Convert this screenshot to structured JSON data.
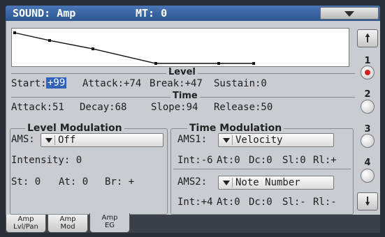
{
  "header": {
    "title": "SOUND: Amp",
    "mt": "MT: 0"
  },
  "level": {
    "section_title": "Level",
    "start_label": "Start:",
    "start_value": "+99",
    "attack": "Attack:+74",
    "break": "Break:+47",
    "sustain": "Sustain:0"
  },
  "time": {
    "section_title": "Time",
    "attack": "Attack:51",
    "decay": "Decay:68",
    "slope": "Slope:94",
    "release": "Release:50"
  },
  "level_mod": {
    "title": "Level Modulation",
    "ams_label": "AMS:",
    "ams_value": "Off",
    "intensity": "Intensity: 0",
    "st": "St: 0",
    "at": "At: 0",
    "br": "Br: +"
  },
  "time_mod": {
    "title": "Time Modulation",
    "ams1_label": "AMS1:",
    "ams1_value": "Velocity",
    "int1": "Int:-6",
    "at1": "At:0",
    "dc1": "Dc:0",
    "sl1": "Sl:0",
    "rl1": "Rl:+",
    "ams2_label": "AMS2:",
    "ams2_value": "Note Number",
    "int2": "Int:+4",
    "at2": "At:0",
    "dc2": "Dc:0",
    "sl2": "Sl:-",
    "rl2": "Rl:-"
  },
  "scroll": {
    "pages": [
      "1",
      "2",
      "3",
      "4"
    ],
    "active_page": "1",
    "up_icon": "arrow-up-icon",
    "down_icon": "arrow-down-icon"
  },
  "tabs": [
    {
      "line1": "Amp",
      "line2": "Lvl/Pan"
    },
    {
      "line1": "Amp",
      "line2": "Mod"
    },
    {
      "line1": "Amp",
      "line2": "EG"
    }
  ],
  "envelope": {
    "start": 99,
    "attack": 74,
    "break": 47,
    "sustain": 0
  },
  "colors": {
    "title_bar": "#3a66a8",
    "panel": "#c9ccd0",
    "selection": "#2f62b8",
    "page_indicator_active": "#d41f1f"
  }
}
